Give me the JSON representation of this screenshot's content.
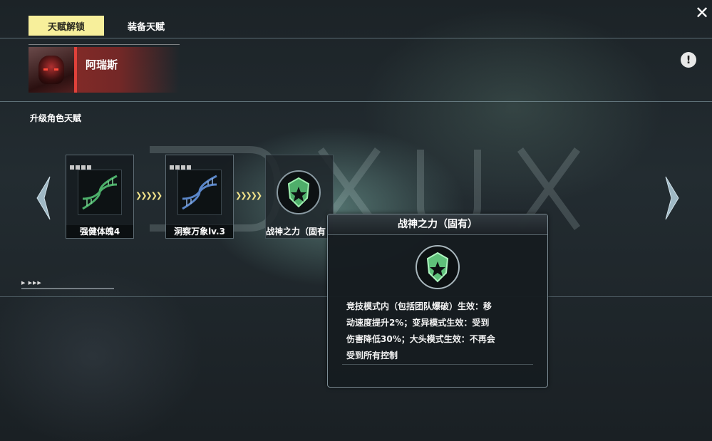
{
  "tabs": [
    {
      "label": "天赋解锁",
      "active": true
    },
    {
      "label": "装备天赋",
      "active": false
    }
  ],
  "hero": {
    "name": "阿瑞斯"
  },
  "section_title": "升级角色天赋",
  "talent_chain": [
    {
      "label": "强健体魄4",
      "icon": "dna-helix-icon",
      "color": "#4caf6a"
    },
    {
      "label": "洞察万象lv.3",
      "icon": "dna-helix-icon",
      "color": "#5a86c8"
    },
    {
      "label": "战神之力（固有",
      "icon": "shield-emblem-icon",
      "color": "#6fd08a"
    }
  ],
  "tooltip": {
    "title": "战神之力（固有）",
    "lines": [
      "竞技模式内（包括团队爆破）生效：移",
      "动速度提升2%；变异模式生效：受到",
      "伤害降低30%；大头模式生效：不再会",
      "受到所有控制"
    ]
  },
  "mini_controls": "▶ ▶▶▶",
  "colors": {
    "tab_active_bg": "#f7ef9b",
    "hero_accent": "#e0413a",
    "emblem_green": "#6fd08a"
  }
}
